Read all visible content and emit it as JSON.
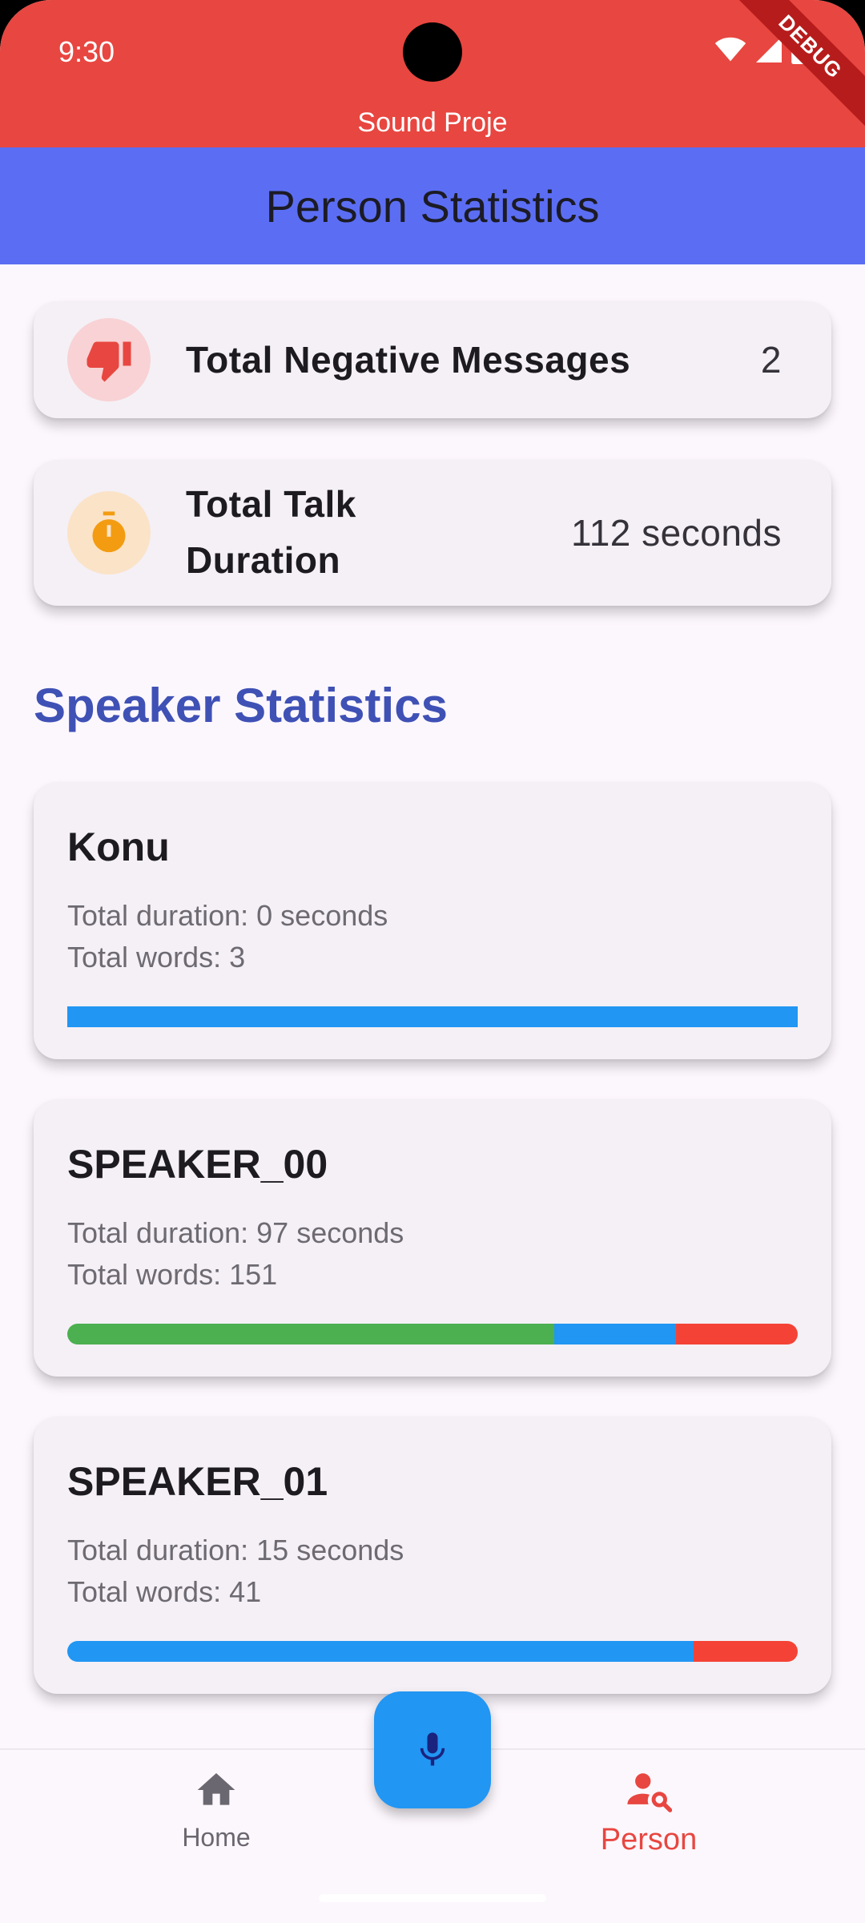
{
  "status_bar": {
    "time": "9:30",
    "debug_label": "DEBUG",
    "app_name": "Sound Proje"
  },
  "app_bar": {
    "title": "Person Statistics"
  },
  "summary": {
    "negative": {
      "label": "Total Negative Messages",
      "value": "2",
      "icon": "thumb-down-icon"
    },
    "talk": {
      "label_line1": "Total Talk",
      "label_line2": "Duration",
      "value": "112 seconds",
      "icon": "timer-icon"
    }
  },
  "section_title": "Speaker Statistics",
  "speakers": [
    {
      "name": "Konu",
      "duration": "Total duration: 0 seconds",
      "words": "Total words: 3",
      "sentiment": {
        "positive": 0,
        "neutral": 1.0,
        "negative": 0
      }
    },
    {
      "name": "SPEAKER_00",
      "duration": "Total duration: 97 seconds",
      "words": "Total words: 151",
      "sentiment": {
        "positive": 0.667,
        "neutral": 0.166,
        "negative": 0.167
      }
    },
    {
      "name": "SPEAKER_01",
      "duration": "Total duration: 15 seconds",
      "words": "Total words: 41",
      "sentiment": {
        "positive": 0,
        "neutral": 0.857,
        "negative": 0.143
      }
    }
  ],
  "colors": {
    "positive": "#4caf50",
    "neutral": "#2196f3",
    "negative": "#f44336",
    "accent": "#e84640"
  },
  "bottom_nav": {
    "items": [
      {
        "label": "Home",
        "icon": "home-icon",
        "selected": false
      },
      {
        "label": "Person",
        "icon": "person-search-icon",
        "selected": true
      }
    ],
    "fab_icon": "mic-icon"
  }
}
